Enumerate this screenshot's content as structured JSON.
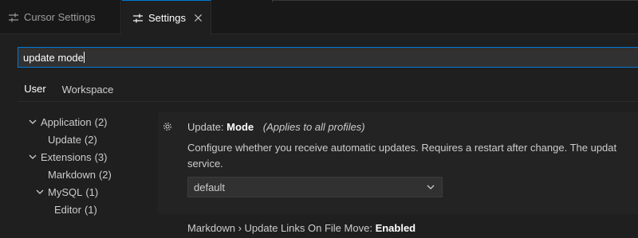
{
  "tabs": {
    "cursor_settings": "Cursor Settings",
    "settings": "Settings"
  },
  "search": {
    "value": "update mode"
  },
  "scope": {
    "user": "User",
    "workspace": "Workspace"
  },
  "toc": {
    "items": [
      {
        "label": "Application",
        "count": "(2)"
      },
      {
        "label": "Update",
        "count": "(2)"
      },
      {
        "label": "Extensions",
        "count": "(3)"
      },
      {
        "label": "Markdown",
        "count": "(2)"
      },
      {
        "label": "MySQL",
        "count": "(1)"
      },
      {
        "label": "Editor",
        "count": "(1)"
      }
    ]
  },
  "setting": {
    "category": "Update:",
    "name": "Mode",
    "note": "(Applies to all profiles)",
    "description_line1": "Configure whether you receive automatic updates. Requires a restart after change. The updat",
    "description_line2": "service.",
    "value": "default"
  },
  "next_setting": {
    "prefix": "Markdown › Update Links On File Move:",
    "value": "Enabled"
  },
  "colors": {
    "accent": "#0078d4",
    "background": "#1f1f1f",
    "panel": "#232323"
  },
  "icons": {
    "tab": "settings-sliders-icon",
    "close": "close-icon",
    "gear": "gear-icon",
    "chevron": "chevron-down-icon"
  }
}
